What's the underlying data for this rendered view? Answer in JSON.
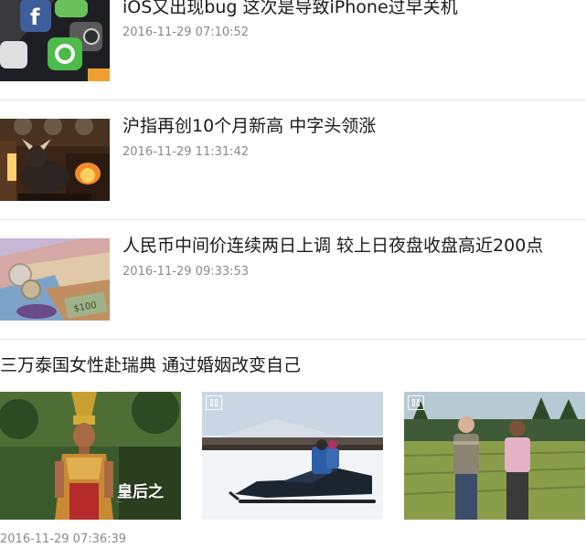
{
  "news": [
    {
      "title": "iOS又出现bug 这次是导致iPhone过早关机",
      "time": "2016-11-29 07:10:52",
      "thumb_icon": "smartphone-apps-image"
    },
    {
      "title": "沪指再创10个月新高 中字头领涨",
      "time": "2016-11-29 11:31:42",
      "thumb_icon": "bull-statue-image"
    },
    {
      "title": "人民币中间价连续两日上调 较上日夜盘收盘高近200点",
      "time": "2016-11-29 09:33:53",
      "thumb_icon": "banknotes-image"
    }
  ],
  "gallery": {
    "title": "三万泰国女性赴瑞典 通过婚姻改变自己",
    "time": "2016-11-29 07:36:39",
    "photos": [
      {
        "icon": "thai-woman-photo",
        "caption": "皇后之",
        "subcaption": "..."
      },
      {
        "icon": "snowmobile-photo"
      },
      {
        "icon": "couple-in-field-photo"
      }
    ]
  },
  "colors": {
    "text": "#1a1a1a",
    "meta": "#8a8a8a",
    "divider": "#e6e6e6"
  }
}
